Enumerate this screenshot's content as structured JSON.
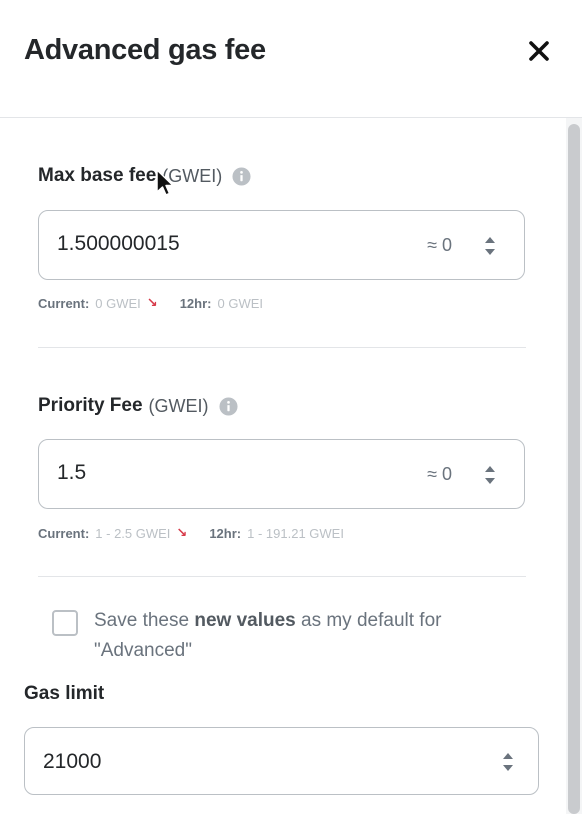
{
  "header": {
    "title": "Advanced gas fee",
    "close_icon": "close-icon"
  },
  "max_base_fee": {
    "label": "Max base fee",
    "unit": "(GWEI)",
    "value": "1.500000015",
    "approx": "≈ 0",
    "current_label": "Current:",
    "current_value": "0 GWEI",
    "trend_icon": "↘",
    "history_label": "12hr:",
    "history_value": "0 GWEI"
  },
  "priority_fee": {
    "label": "Priority Fee",
    "unit": "(GWEI)",
    "value": "1.5",
    "approx": "≈ 0",
    "current_label": "Current:",
    "current_value": "1 - 2.5 GWEI",
    "trend_icon": "↘",
    "history_label": "12hr:",
    "history_value": "1 - 191.21 GWEI"
  },
  "save_default": {
    "checked": false,
    "text_before": "Save these ",
    "text_bold": "new values",
    "text_after": " as my default for \"Advanced\""
  },
  "gas_limit": {
    "label": "Gas limit",
    "value": "21000"
  },
  "colors": {
    "text": "#24272a",
    "border": "#bbc0c5",
    "trend_down": "#d73a49",
    "muted": "#bbc0c5"
  }
}
